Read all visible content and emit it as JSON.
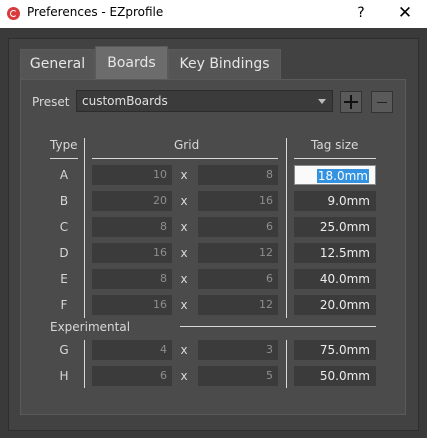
{
  "window": {
    "title": "Preferences - EZprofile",
    "help_label": "?",
    "close_label": "✕"
  },
  "tabs": [
    "General",
    "Boards",
    "Key Bindings"
  ],
  "active_tab": "Boards",
  "preset": {
    "label": "Preset",
    "value": "customBoards"
  },
  "headers": {
    "type": "Type",
    "grid": "Grid",
    "tag_size": "Tag size",
    "experimental": "Experimental"
  },
  "separator": "x",
  "rows": [
    {
      "type": "A",
      "w": "10",
      "h": "8",
      "tag": "18.0mm"
    },
    {
      "type": "B",
      "w": "20",
      "h": "16",
      "tag": "9.0mm"
    },
    {
      "type": "C",
      "w": "8",
      "h": "6",
      "tag": "25.0mm"
    },
    {
      "type": "D",
      "w": "16",
      "h": "12",
      "tag": "12.5mm"
    },
    {
      "type": "E",
      "w": "8",
      "h": "6",
      "tag": "40.0mm"
    },
    {
      "type": "F",
      "w": "16",
      "h": "12",
      "tag": "20.0mm"
    }
  ],
  "experimental_rows": [
    {
      "type": "G",
      "w": "4",
      "h": "3",
      "tag": "75.0mm"
    },
    {
      "type": "H",
      "w": "6",
      "h": "5",
      "tag": "50.0mm"
    }
  ],
  "colors": {
    "selection": "#3393e0",
    "icon_red": "#d83b3b",
    "panel": "#4b4b4b"
  }
}
